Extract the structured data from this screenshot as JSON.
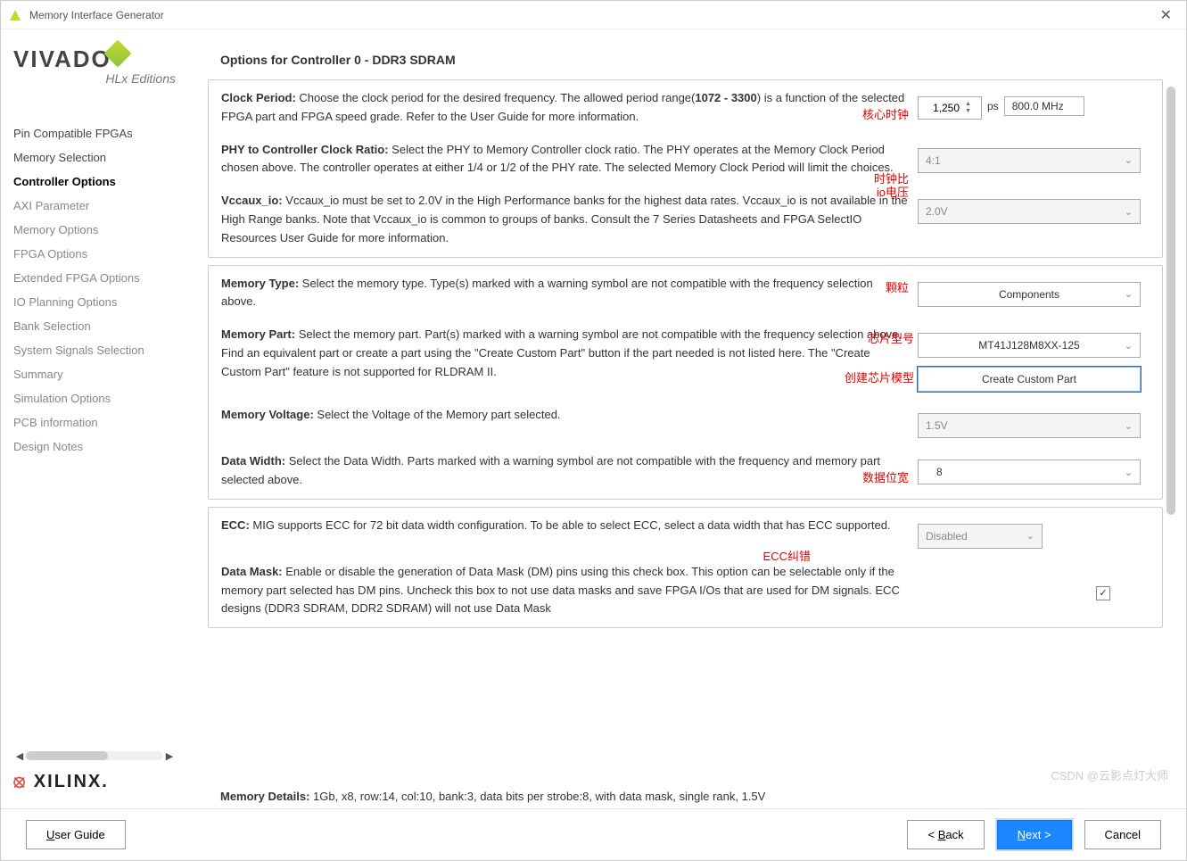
{
  "window": {
    "title": "Memory Interface Generator"
  },
  "logo": {
    "brand": "VIVADO",
    "sub": "HLx Editions",
    "xilinx": "XILINX."
  },
  "nav": {
    "items": [
      {
        "label": "Pin Compatible FPGAs",
        "state": "enabled"
      },
      {
        "label": "Memory Selection",
        "state": "enabled"
      },
      {
        "label": "Controller Options",
        "state": "active"
      },
      {
        "label": "AXI Parameter",
        "state": "disabled"
      },
      {
        "label": "Memory Options",
        "state": "disabled"
      },
      {
        "label": "FPGA Options",
        "state": "disabled"
      },
      {
        "label": "Extended FPGA Options",
        "state": "disabled"
      },
      {
        "label": "IO Planning Options",
        "state": "disabled"
      },
      {
        "label": "Bank Selection",
        "state": "disabled"
      },
      {
        "label": "System Signals Selection",
        "state": "disabled"
      },
      {
        "label": "Summary",
        "state": "disabled"
      },
      {
        "label": "Simulation Options",
        "state": "disabled"
      },
      {
        "label": "PCB information",
        "state": "disabled"
      },
      {
        "label": "Design Notes",
        "state": "disabled"
      }
    ]
  },
  "page": {
    "title": "Options for Controller 0 - DDR3 SDRAM",
    "clock": {
      "label": "Clock Period:",
      "desc_pre": " Choose the clock period for the desired frequency. The allowed period range(",
      "range": "1072 - 3300",
      "desc_post": ") is a function of the selected FPGA part and FPGA speed grade. Refer to the User Guide for more information.",
      "value": "1,250",
      "unit": "ps",
      "mhz": "800.0 MHz",
      "anno": "核心时钟"
    },
    "ratio": {
      "label": "PHY to Controller Clock Ratio:",
      "desc": " Select the PHY to Memory Controller clock ratio. The PHY operates at the Memory Clock Period chosen above. The controller operates at either 1/4 or 1/2 of the PHY rate. The selected Memory Clock Period will limit the choices.",
      "value": "4:1",
      "anno": "时钟比"
    },
    "vccaux": {
      "label": "Vccaux_io:",
      "desc": " Vccaux_io must be set to 2.0V in the High Performance banks for the highest data rates. Vccaux_io is not available in the High Range banks. Note that Vccaux_io is common to groups of banks. Consult the 7 Series Datasheets and FPGA SelectIO Resources User Guide for more information.",
      "value": "2.0V",
      "anno": "io电压"
    },
    "memtype": {
      "label": "Memory Type:",
      "desc": " Select the memory type. Type(s) marked with a warning symbol are not compatible with the frequency selection above.",
      "value": "Components",
      "anno": "颗粒"
    },
    "mempart": {
      "label": "Memory Part:",
      "desc": " Select the memory part. Part(s) marked with a warning symbol are not compatible with the frequency selection above. Find an equivalent part or create a part using the \"Create Custom Part\" button if the part needed is not listed here. The \"Create Custom Part\" feature is not supported for RLDRAM II.",
      "value": "MT41J128M8XX-125",
      "anno_part": "芯片型号",
      "anno_btn": "创建芯片模型",
      "btn": "Create Custom Part"
    },
    "voltage": {
      "label": "Memory Voltage:",
      "desc": " Select the Voltage of the Memory part selected.",
      "value": "1.5V"
    },
    "width": {
      "label": "Data Width:",
      "desc": " Select the Data Width. Parts marked with a warning symbol are not compatible with the frequency and memory part selected above.",
      "value": "8",
      "anno": "数据位宽"
    },
    "ecc": {
      "label": "ECC:",
      "desc": " MIG supports ECC for 72 bit data width configuration. To be able to select ECC, select a data width that has ECC supported.",
      "value": "Disabled",
      "anno": "ECC纠错"
    },
    "mask": {
      "label": "Data Mask:",
      "desc": " Enable or disable the generation of Data Mask (DM) pins using this check box. This option can be selectable only if the memory part selected has DM pins. Uncheck this box to not use data masks and save FPGA I/Os that are used for DM signals. ECC designs (DDR3 SDRAM, DDR2 SDRAM) will not use Data Mask",
      "checked": true
    },
    "details": {
      "label": "Memory Details:",
      "value": " 1Gb, x8, row:14, col:10, bank:3, data bits per strobe:8, with data mask, single rank, 1.5V"
    }
  },
  "footer": {
    "userguide": "User Guide",
    "back": "< Back",
    "next": "Next >",
    "cancel": "Cancel"
  },
  "watermark": "CSDN @云影点灯大师"
}
